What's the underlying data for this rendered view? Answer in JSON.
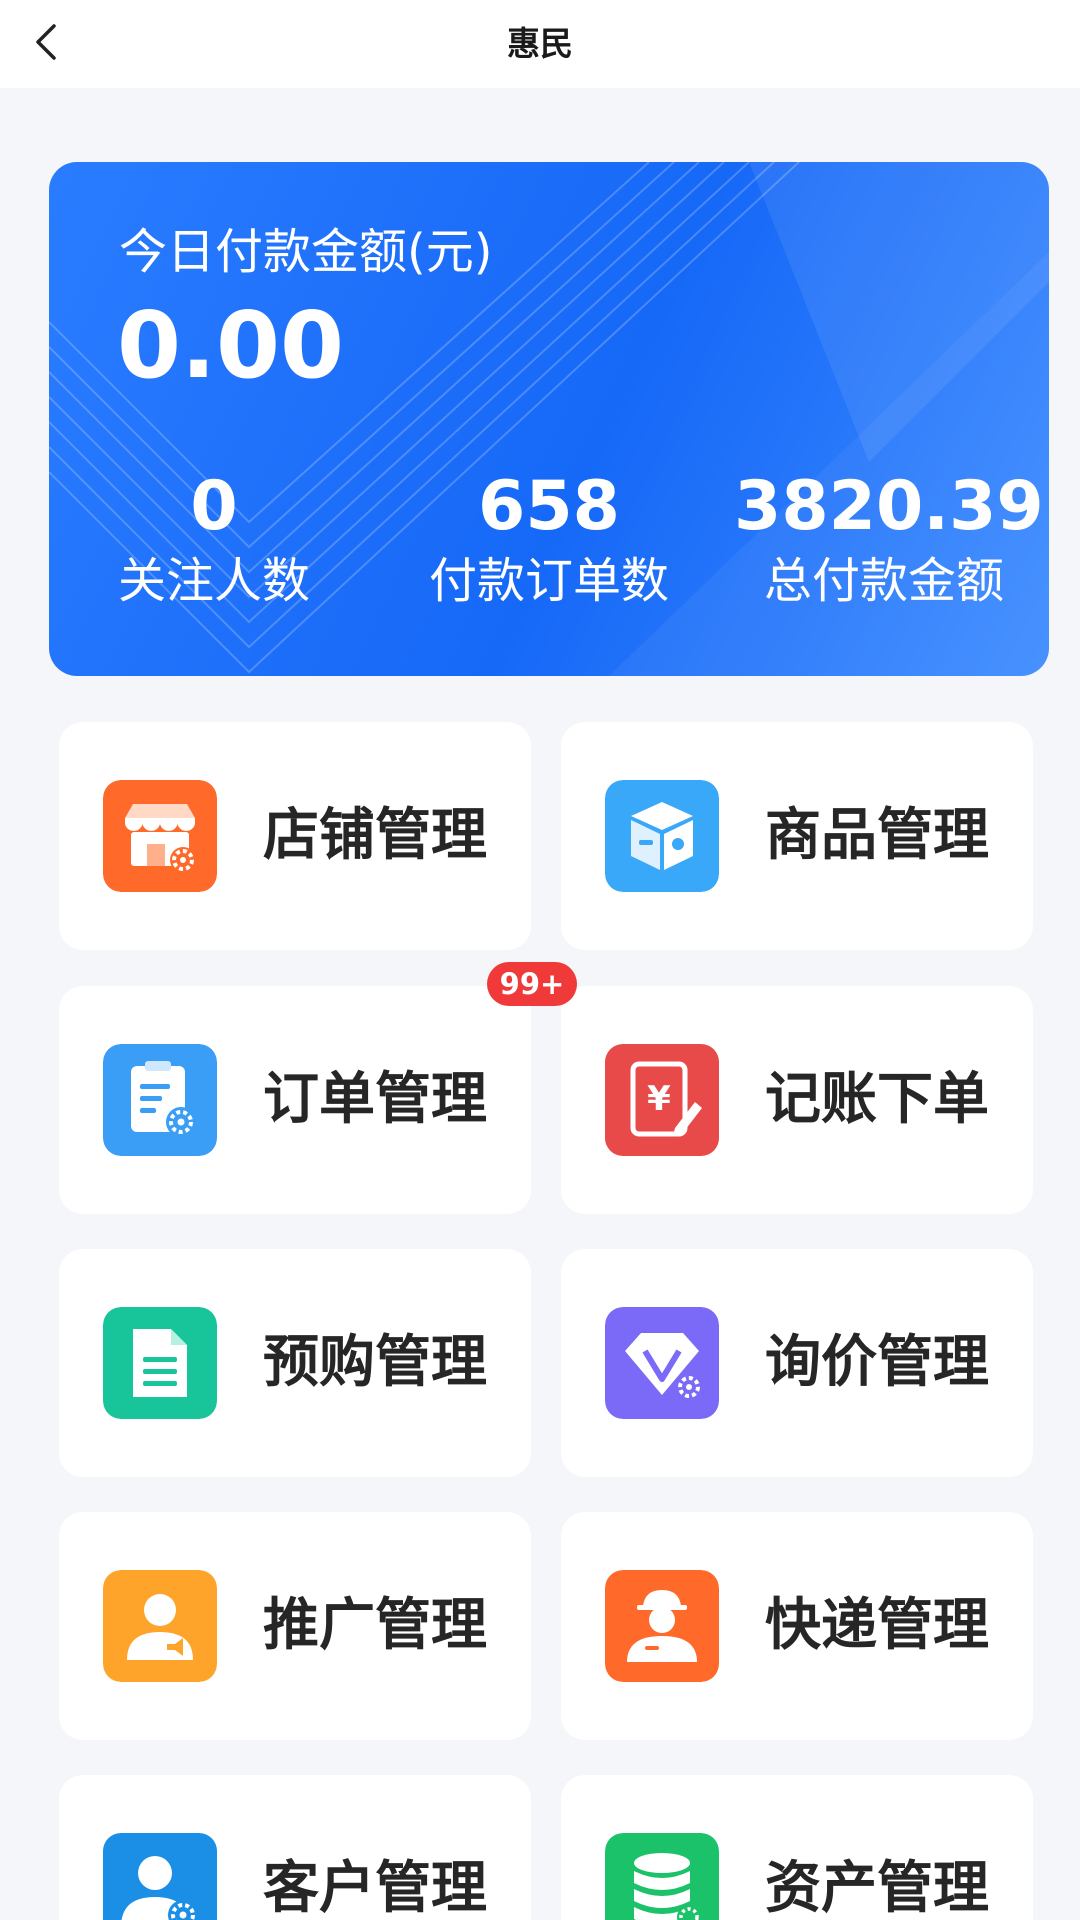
{
  "header": {
    "title": "惠民"
  },
  "stats": {
    "today_label": "今日付款金额(元)",
    "today_value": "0.00",
    "items": [
      {
        "value": "0",
        "label": "关注人数"
      },
      {
        "value": "658",
        "label": "付款订单数"
      },
      {
        "value": "3820.39",
        "label": "总付款金额"
      }
    ]
  },
  "menu": [
    {
      "label": "店铺管理",
      "icon": "store-icon",
      "color": "#ff6a2b"
    },
    {
      "label": "商品管理",
      "icon": "product-box-icon",
      "color": "#3aa8f8"
    },
    {
      "label": "订单管理",
      "icon": "order-clipboard-icon",
      "color": "#3a9ef7",
      "badge": "99+"
    },
    {
      "label": "记账下单",
      "icon": "bookkeeping-icon",
      "color": "#e84a4a"
    },
    {
      "label": "预购管理",
      "icon": "document-icon",
      "color": "#18c49a"
    },
    {
      "label": "询价管理",
      "icon": "diamond-icon",
      "color": "#7a6af7"
    },
    {
      "label": "推广管理",
      "icon": "promoter-icon",
      "color": "#ffa42b"
    },
    {
      "label": "快递管理",
      "icon": "courier-icon",
      "color": "#ff6a2b"
    },
    {
      "label": "客户管理",
      "icon": "customer-icon",
      "color": "#1b8fe6"
    },
    {
      "label": "资产管理",
      "icon": "database-icon",
      "color": "#1cc26a"
    }
  ]
}
